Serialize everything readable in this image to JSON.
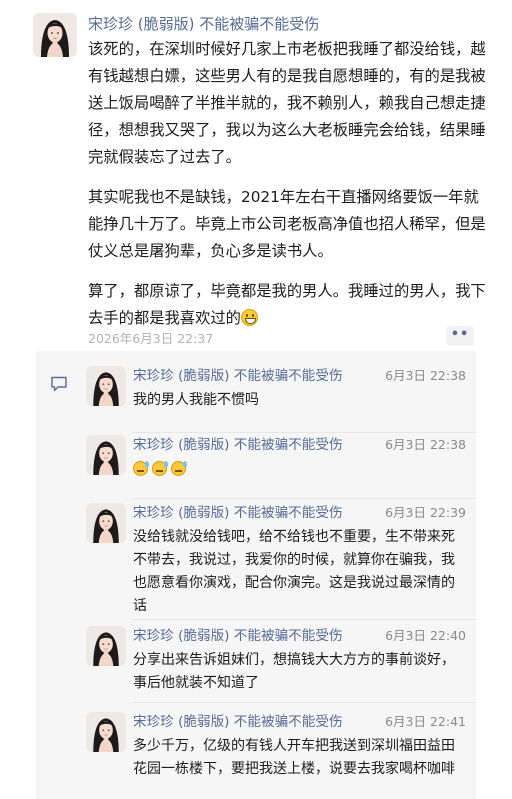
{
  "post": {
    "author": "宋珍珍 (脆弱版) 不能被骗不能受伤",
    "paragraphs": [
      "该死的，在深圳时候好几家上市老板把我睡了都没给钱，越有钱越想白嫖，这些男人有的是我自愿想睡的，有的是我被送上饭局喝醉了半推半就的，我不赖别人，赖我自己想走捷径，想想我又哭了，我以为这么大老板睡完会给钱，结果睡完就假装忘了过去了。",
      "其实呢我也不是缺钱，2021年左右干直播网络要饭一年就能挣几十万了。毕竟上市公司老板高净值也招人稀罕，但是仗义总是屠狗辈，负心多是读书人。",
      "算了，都原谅了，毕竟都是我的男人。我睡过的男人，我下去手的都是我喜欢过的"
    ],
    "end_emoji": "grin-emoji",
    "time": "2026年6月3日 22:37",
    "more_label": "••"
  },
  "comments": [
    {
      "name": "宋珍珍 (脆弱版) 不能被骗不能受伤",
      "time": "6月3日 22:38",
      "text": "我的男人我能不惯吗"
    },
    {
      "name": "宋珍珍 (脆弱版) 不能被骗不能受伤",
      "time": "6月3日 22:38",
      "text": "",
      "emojis": [
        "sweat-emoji",
        "sweat-emoji",
        "sweat-emoji"
      ]
    },
    {
      "name": "宋珍珍 (脆弱版) 不能被骗不能受伤",
      "time": "6月3日 22:39",
      "text": "没给钱就没给钱吧，给不给钱也不重要，生不带来死不带去，我说过，我爱你的时候，就算你在骗我，我也愿意看你演戏，配合你演完。这是我说过最深情的话"
    },
    {
      "name": "宋珍珍 (脆弱版) 不能被骗不能受伤",
      "time": "6月3日 22:40",
      "text": "分享出来告诉姐妹们，想搞钱大大方方的事前谈好，事后他就装不知道了"
    },
    {
      "name": "宋珍珍 (脆弱版) 不能被骗不能受伤",
      "time": "6月3日 22:41",
      "text": "多少千万，亿级的有钱人开车把我送到深圳福田益田花园一栋楼下，要把我送上楼，说要去我家喝杯咖啡"
    }
  ],
  "colors": {
    "name": "#566b94",
    "time": "#b2b2b2",
    "comment_bg": "#f6f6f6"
  },
  "icons": {
    "comment": "comment-bubble-icon",
    "avatar": "avatar-portrait"
  }
}
